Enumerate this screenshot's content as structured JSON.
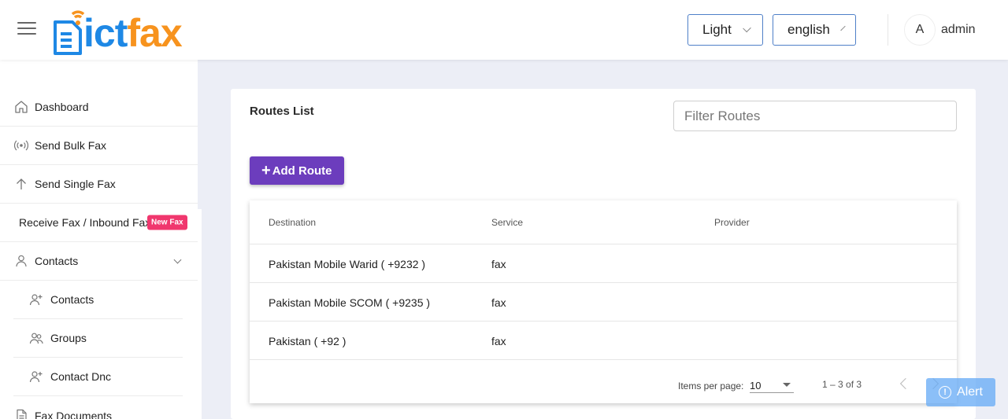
{
  "brand": {
    "part1": "ict",
    "part2": "fax"
  },
  "header": {
    "theme_value": "Light",
    "language_value": "english",
    "avatar_initial": "A",
    "username": "admin"
  },
  "sidebar": {
    "items": [
      {
        "label": "Dashboard",
        "icon": "home-icon"
      },
      {
        "label": "Send Bulk Fax",
        "icon": "broadcast-icon"
      },
      {
        "label": "Send Single Fax",
        "icon": "arrow-up-icon"
      },
      {
        "label": "Receive Fax / Inbound Fax",
        "badge": "New Fax"
      },
      {
        "label": "Contacts",
        "icon": "person-icon",
        "expanded": true
      },
      {
        "label": "Contacts",
        "icon": "person-add-icon"
      },
      {
        "label": "Groups",
        "icon": "group-icon"
      },
      {
        "label": "Contact Dnc",
        "icon": "person-add-icon"
      },
      {
        "label": "Fax Documents",
        "icon": "document-icon"
      }
    ]
  },
  "main": {
    "title": "Routes List",
    "filter_placeholder": "Filter Routes",
    "add_button": "Add Route",
    "table": {
      "headers": [
        "Destination",
        "Service",
        "Provider"
      ],
      "rows": [
        {
          "destination": "Pakistan Mobile Warid ( +9232 )",
          "service": "fax",
          "provider": ""
        },
        {
          "destination": "Pakistan Mobile SCOM ( +9235 )",
          "service": "fax",
          "provider": ""
        },
        {
          "destination": "Pakistan ( +92 )",
          "service": "fax",
          "provider": ""
        }
      ]
    },
    "paginator": {
      "items_per_page_label": "Items per page:",
      "page_size": "10",
      "range": "1 – 3 of 3"
    }
  },
  "alert": {
    "label": "Alert"
  },
  "colors": {
    "accent_purple": "#6c3dbd",
    "brand_blue": "#1e88e5",
    "brand_orange": "#f7931e",
    "badge_pink": "#f0376e"
  }
}
